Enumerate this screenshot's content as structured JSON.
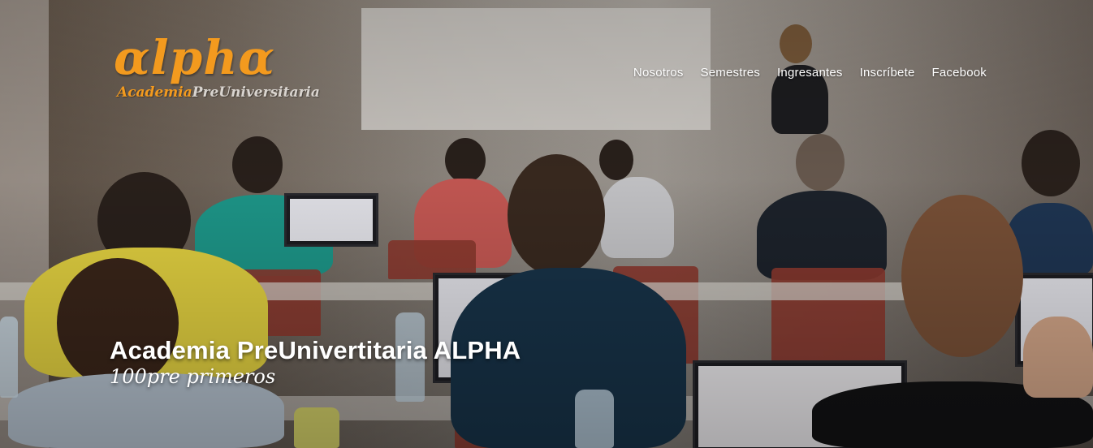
{
  "logo": {
    "main": "αlphα",
    "sub_part1": "Academia",
    "sub_part2": "PreUniversitaria"
  },
  "nav": {
    "items": [
      "Nosotros",
      "Semestres",
      "Ingresantes",
      "Inscríbete",
      "Facebook"
    ]
  },
  "hero": {
    "title": "Academia PreUnivertitaria ALPHA",
    "tagline": "100pre primeros"
  },
  "colors": {
    "brand_orange": "#f39a1e",
    "text_white": "#ffffff"
  }
}
